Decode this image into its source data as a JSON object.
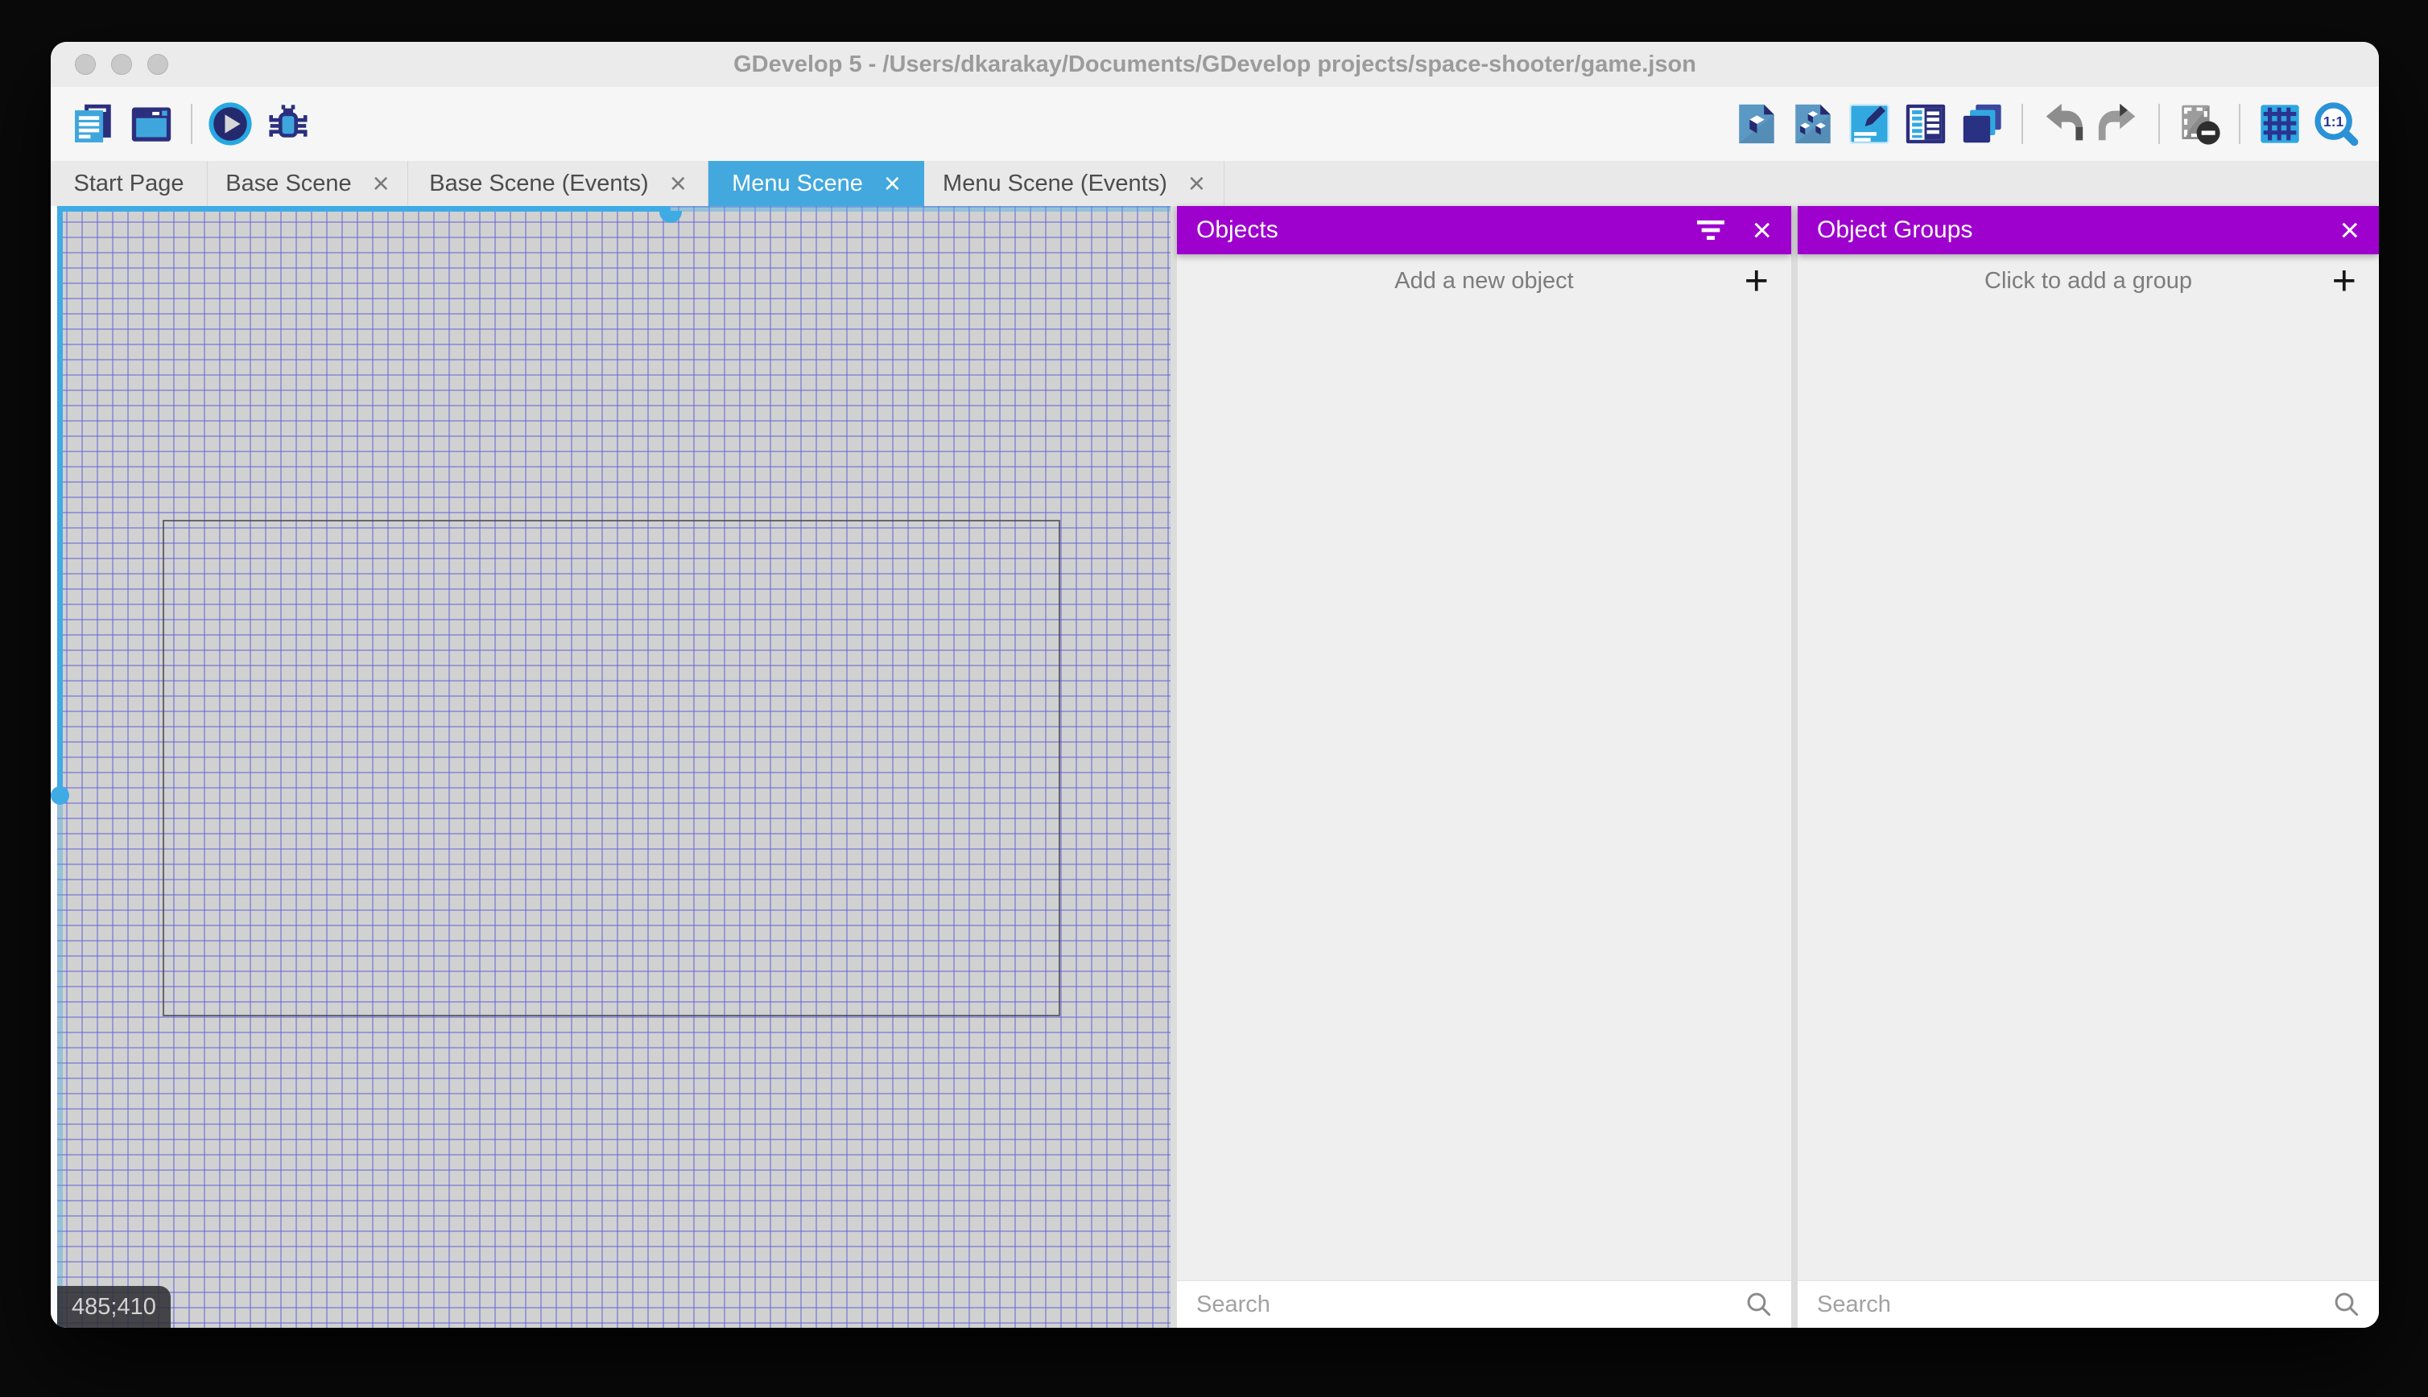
{
  "window": {
    "title": "GDevelop 5 - /Users/dkarakay/Documents/GDevelop projects/space-shooter/game.json"
  },
  "toolbar": {
    "left_icons": [
      "project-manager-icon",
      "scene-window-icon",
      "preview-play-icon",
      "debug-icon"
    ],
    "right_icons": [
      "objects-editor-icon",
      "object-groups-icon",
      "properties-icon",
      "instances-list-icon",
      "layers-icon",
      "undo-icon",
      "redo-icon",
      "toggle-mask-icon",
      "toggle-grid-icon",
      "zoom-1to1-icon"
    ],
    "zoom_icon_label": "1:1"
  },
  "tabs": [
    {
      "label": "Start Page",
      "closable": false,
      "active": false
    },
    {
      "label": "Base Scene",
      "closable": true,
      "active": false
    },
    {
      "label": "Base Scene (Events)",
      "closable": true,
      "active": false
    },
    {
      "label": "Menu Scene",
      "closable": true,
      "active": true
    },
    {
      "label": "Menu Scene (Events)",
      "closable": true,
      "active": false
    }
  ],
  "ui": {
    "close_glyph": "×",
    "plus_glyph": "+"
  },
  "canvas": {
    "cursor_coordinates": "485;410"
  },
  "panels": {
    "objects": {
      "title": "Objects",
      "add_label": "Add a new object",
      "search_placeholder": "Search"
    },
    "object_groups": {
      "title": "Object Groups",
      "add_label": "Click to add a group",
      "search_placeholder": "Search"
    }
  },
  "colors": {
    "accent_purple": "#9e00cd",
    "active_tab_blue": "#42a8de",
    "scrollbar_blue": "#3fabe5",
    "icon_navy": "#2b2f7e",
    "icon_blue": "#3fa6dd",
    "grid_line": "#6262d7",
    "canvas_background": "#d1d1d1"
  }
}
